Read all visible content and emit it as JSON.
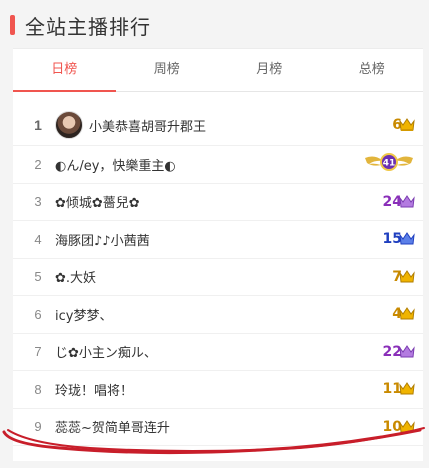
{
  "header": {
    "title": "全站主播排行",
    "accent_color": "#f0554f"
  },
  "tabs": [
    {
      "label": "日榜",
      "active": true
    },
    {
      "label": "周榜",
      "active": false
    },
    {
      "label": "月榜",
      "active": false
    },
    {
      "label": "总榜",
      "active": false
    }
  ],
  "ranking": [
    {
      "rank": "1",
      "name": "小美恭喜胡哥升郡王",
      "level": "6",
      "level_color": "#c98a00",
      "has_avatar": true
    },
    {
      "rank": "2",
      "name": "◐ん/ey，快樂重主◐",
      "level": "41",
      "level_color": "#6b2fb3",
      "badge": "winged-crest-icon"
    },
    {
      "rank": "3",
      "name": "✿倾城✿薔兒✿",
      "level": "24",
      "level_color": "#8a2fb9"
    },
    {
      "rank": "4",
      "name": "海豚团♪♪小茜茜",
      "level": "15",
      "level_color": "#1f3fbf"
    },
    {
      "rank": "5",
      "name": "✿.大妖",
      "level": "7",
      "level_color": "#c98a00"
    },
    {
      "rank": "6",
      "name": "icy梦梦、",
      "level": "4",
      "level_color": "#c98a00"
    },
    {
      "rank": "7",
      "name": "じ✿小主ン痴ル、",
      "level": "22",
      "level_color": "#8a2fb9"
    },
    {
      "rank": "8",
      "name": "玲珑！唱将！",
      "level": "11",
      "level_color": "#c98a00"
    },
    {
      "rank": "9",
      "name": "蕊蕊~贺简单哥连升",
      "level": "10",
      "level_color": "#c98a00"
    }
  ]
}
